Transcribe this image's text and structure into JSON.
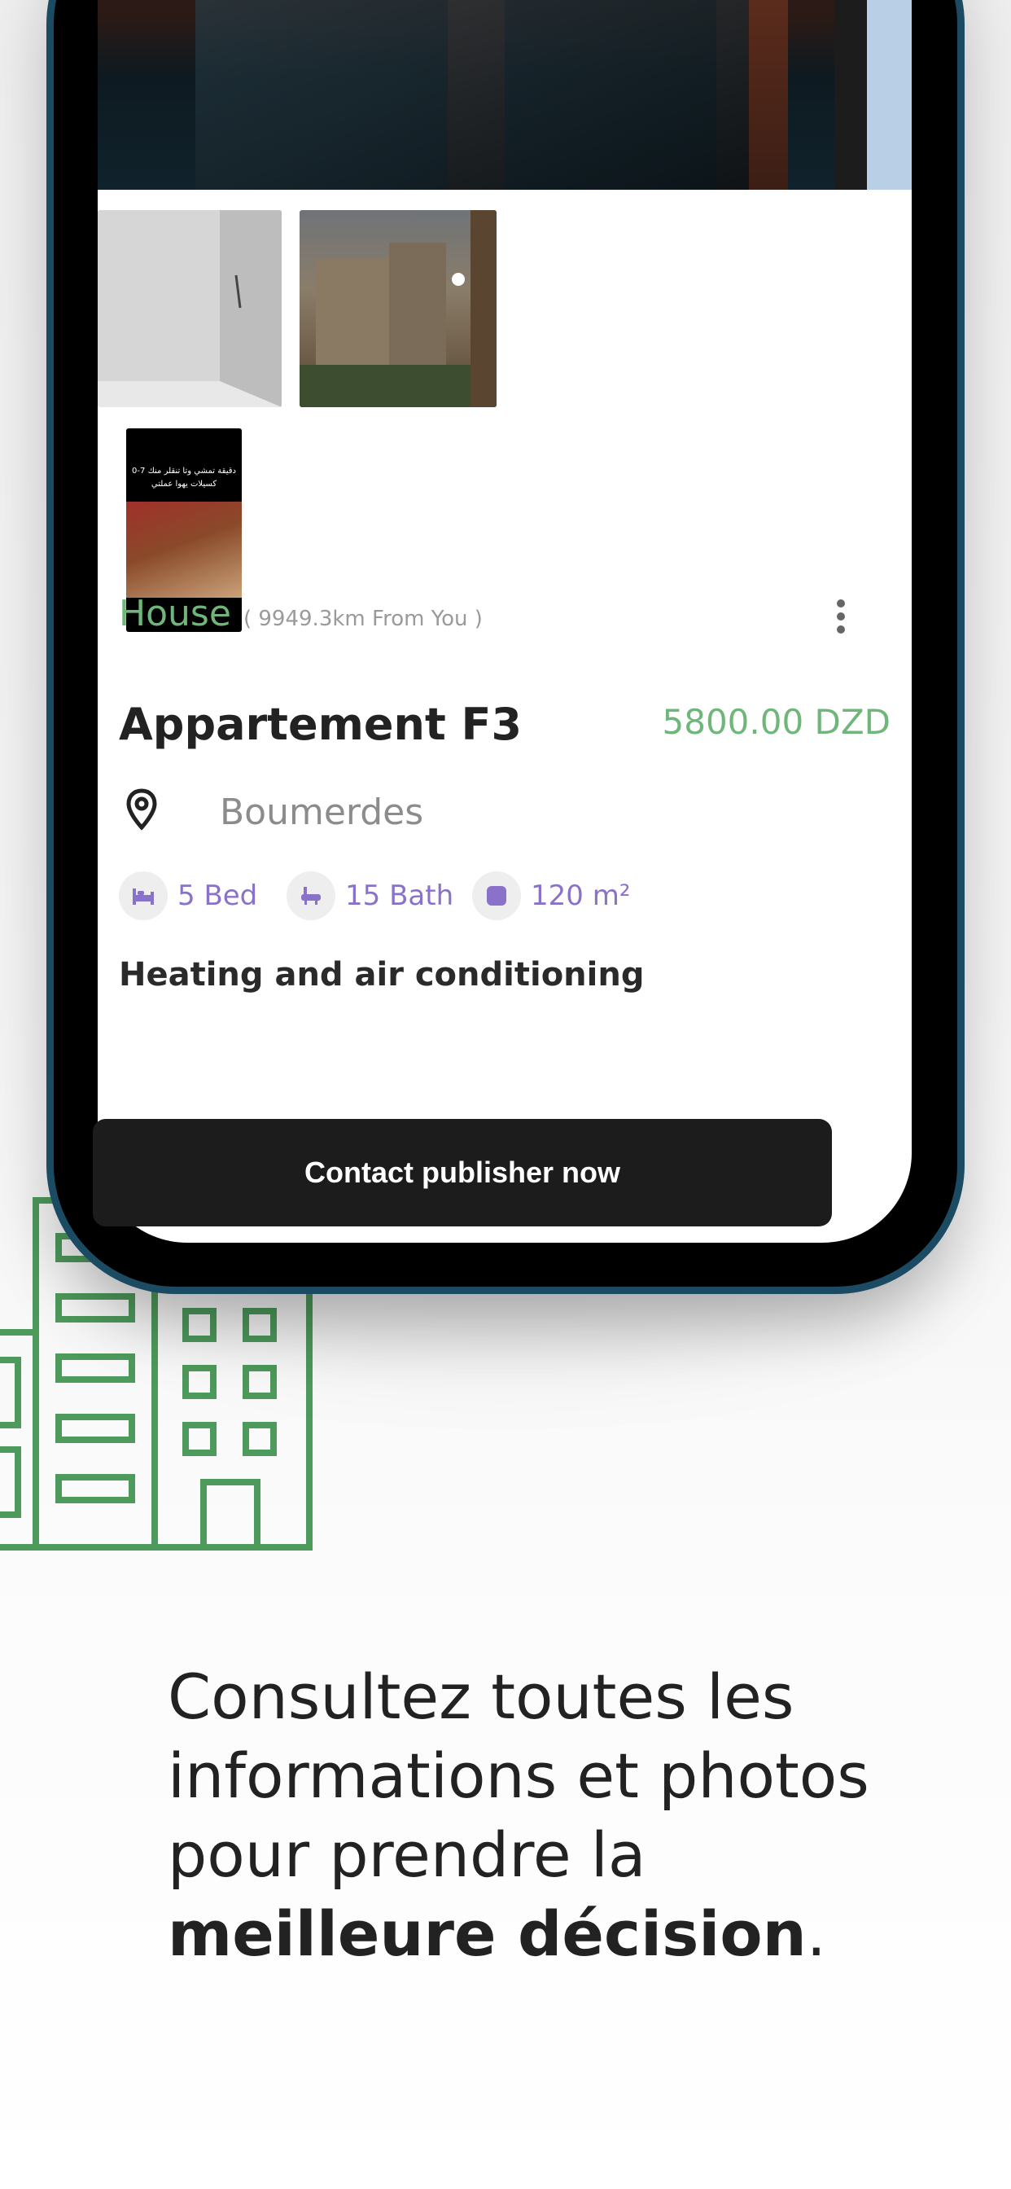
{
  "listing": {
    "type": "House",
    "distance": "( 9949.3km From You )",
    "title": "Appartement F3",
    "price": "5800.00 DZD",
    "location": "Boumerdes",
    "features": {
      "bed": "5 Bed",
      "bath": "15 Bath",
      "area": "120 m²"
    },
    "amenity": "Heating and air conditioning",
    "thumbnail_caption": "دقيقة تمشي وتا تنقلر منك 7-0 كسيلات يهوا عملتي"
  },
  "cta": {
    "label": "Contact publisher now"
  },
  "tagline": {
    "line_start": "Consultez toutes les informations et photos pour prendre la ",
    "emphasis": "meilleure décision",
    "end": "."
  },
  "icons": {
    "menu": "kebab-menu-icon",
    "location": "location-pin-icon",
    "bed": "bed-icon",
    "bath": "bathtub-icon",
    "area": "area-icon",
    "illustration": "building-icon"
  },
  "colors": {
    "accent_green": "#6fb67a",
    "feature_purple": "#8a71c9",
    "illustration_green": "#4e9a5c",
    "cta_background": "#1c1c1c",
    "phone_frame": "#1b4a63"
  }
}
